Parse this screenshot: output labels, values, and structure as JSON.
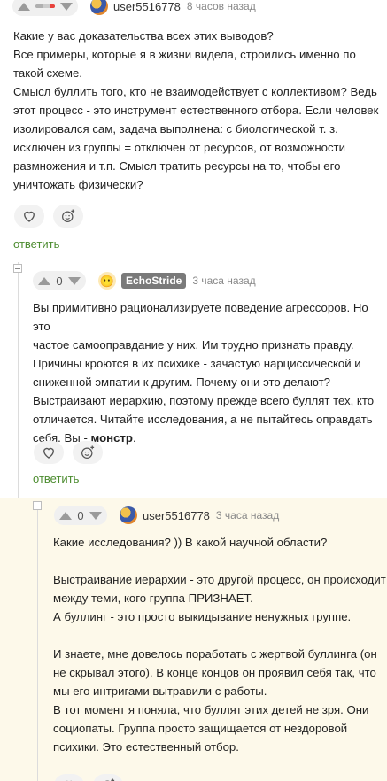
{
  "comments": [
    {
      "rating": "",
      "username": "user5516778",
      "time": "8 часов назад",
      "lines": [
        "Какие у вас доказательства всех этих выводов?",
        "Все примеры, которые я в жизни видела, строились именно по",
        "такой схеме.",
        "Смысл буллить того, кто не взаимодействует с коллективом? Ведь",
        "этот процесс - это инструмент естественного отбора. Если человек",
        "изолировался сам, задача выполнена: с биологической т. з.",
        "исключен из группы = отключен от ресурсов, от возможности",
        "размножения и т.п. Смысл тратить ресурсы на то, чтобы его",
        "уничтожать физически?"
      ],
      "reply_label": "ответить"
    },
    {
      "rating": "0",
      "username": "EchoStride",
      "time": "3 часа назад",
      "lines": [
        "Вы примитивно рационализируете поведение агрессоров. Но это",
        "частое самооправдание у них. Им трудно признать правду.",
        "Причины кроются в их психике - зачастую нарциссической и",
        "сниженной эмпатии к другим. Почему они это делают?",
        "Выстраивают иерархию, поэтому прежде всего буллят тех, кто",
        "отличается. Читайте исследования, а не пытайтесь оправдать"
      ],
      "last_line_prefix": "себя. Вы - ",
      "last_line_bold": "монстр",
      "last_line_suffix": ".",
      "reply_label": "ответить"
    },
    {
      "rating": "0",
      "username": "user5516778",
      "time": "3 часа назад",
      "lines": [
        "Какие исследования? )) В какой научной области?",
        "",
        "Выстраивание иерархии - это другой процесс, он происходит",
        "между теми, кого группа ПРИЗНАЕТ.",
        "А буллинг - это просто выкидывание ненужных группе.",
        "",
        "И знаете, мне довелось поработать с жертвой буллинга (он",
        "не скрывал этого). В конце концов он проявил себя так, что",
        "мы его интригами вытравили с работы.",
        "В тот момент я поняла, что буллят этих детей не зря. Они",
        "социопаты. Группа просто защищается от нездоровой",
        "психики. Это естественный отбор."
      ]
    }
  ],
  "icons": {
    "like": "heart-icon",
    "react": "smile-plus-icon",
    "up": "arrow-up-icon",
    "down": "arrow-down-icon",
    "collapse": "minus-icon"
  },
  "colors": {
    "reply": "#4c8c2f",
    "negative_rating": "#e8413b",
    "thread_bg": "#fdf9ea"
  }
}
